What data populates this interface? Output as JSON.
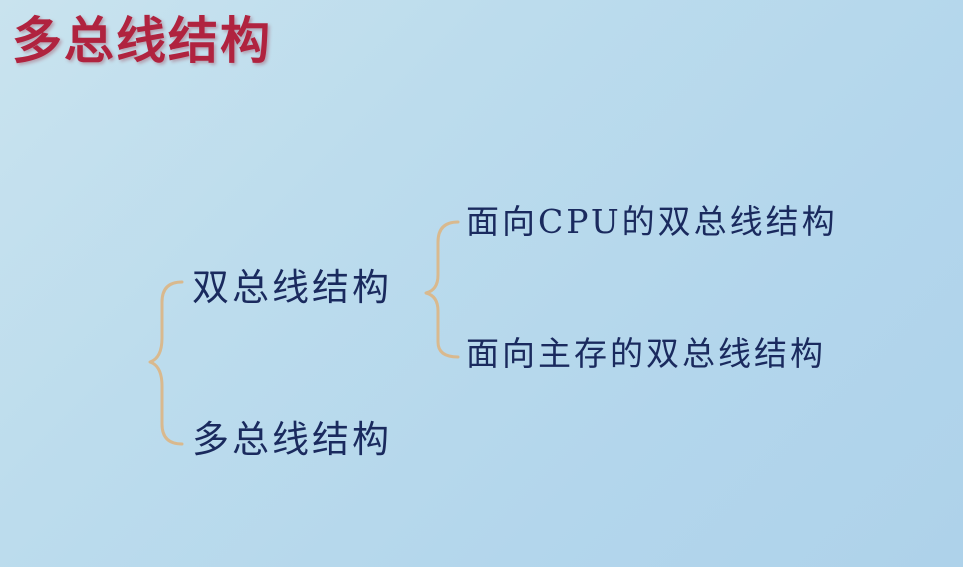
{
  "slide": {
    "title": "多总线结构"
  },
  "tree": {
    "dual_bus": {
      "label": "双总线结构",
      "children": [
        {
          "label": "面向CPU的双总线结构"
        },
        {
          "label": "面向主存的双总线结构"
        }
      ]
    },
    "multi_bus": {
      "label": "多总线结构"
    }
  },
  "colors": {
    "title": "#b0233f",
    "text": "#1a2a5e",
    "brace": "#d9b98e",
    "background": "#bcdced"
  }
}
